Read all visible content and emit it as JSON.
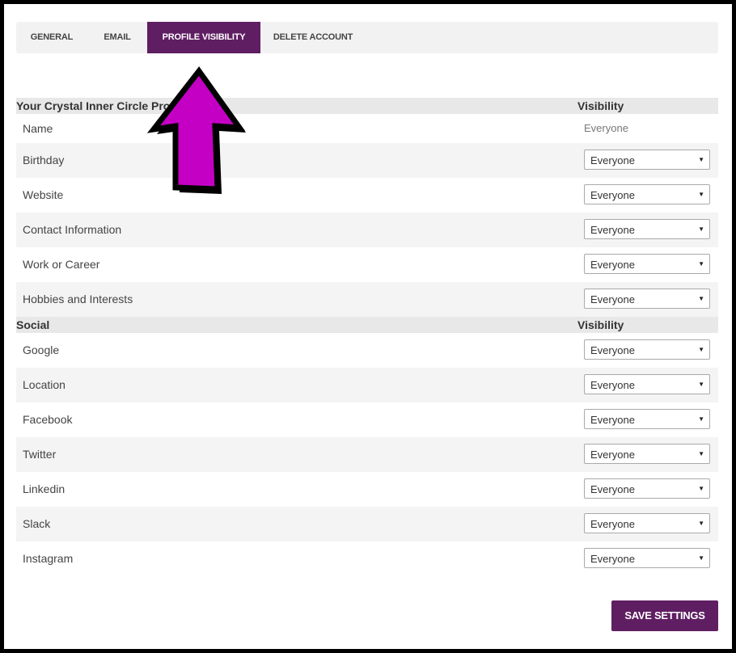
{
  "tabs": [
    {
      "label": "GENERAL",
      "active": false
    },
    {
      "label": "EMAIL",
      "active": false
    },
    {
      "label": "PROFILE VISIBILITY",
      "active": true
    },
    {
      "label": "DELETE ACCOUNT",
      "active": false
    }
  ],
  "profile_section": {
    "title": "Your Crystal Inner Circle Profile",
    "visibility_header": "Visibility",
    "name_row": {
      "label": "Name",
      "visibility": "Everyone"
    },
    "rows": [
      {
        "label": "Birthday",
        "value": "Everyone"
      },
      {
        "label": "Website",
        "value": "Everyone"
      },
      {
        "label": "Contact Information",
        "value": "Everyone"
      },
      {
        "label": "Work or Career",
        "value": "Everyone"
      },
      {
        "label": "Hobbies and Interests",
        "value": "Everyone"
      }
    ]
  },
  "social_section": {
    "title": "Social",
    "visibility_header": "Visibility",
    "rows": [
      {
        "label": "Google",
        "value": "Everyone"
      },
      {
        "label": "Location",
        "value": "Everyone"
      },
      {
        "label": "Facebook",
        "value": "Everyone"
      },
      {
        "label": "Twitter",
        "value": "Everyone"
      },
      {
        "label": "Linkedin",
        "value": "Everyone"
      },
      {
        "label": "Slack",
        "value": "Everyone"
      },
      {
        "label": "Instagram",
        "value": "Everyone"
      }
    ]
  },
  "save_button": {
    "label": "SAVE SETTINGS"
  },
  "colors": {
    "accent": "#5f1e62",
    "arrow_fill": "#c400c4"
  },
  "icons": {
    "select_caret": "caret-down-icon",
    "annotation": "arrow-up-icon"
  }
}
